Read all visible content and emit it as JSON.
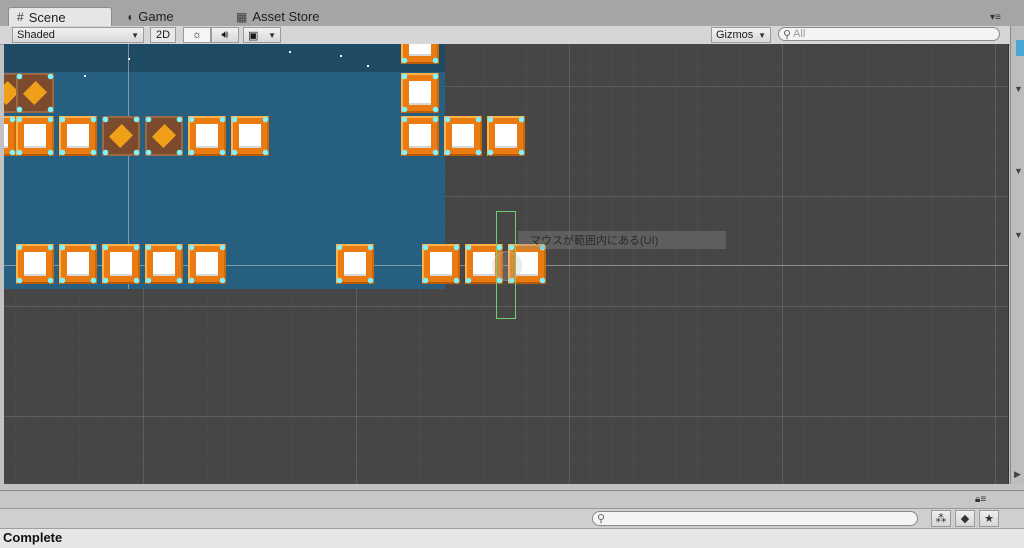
{
  "tabs": [
    {
      "label": "Scene",
      "icon": "grid-icon",
      "active": true
    },
    {
      "label": "Game",
      "icon": "pacman-icon",
      "active": false
    },
    {
      "label": "Asset Store",
      "icon": "store-icon",
      "active": false
    }
  ],
  "toolbar": {
    "shading_mode": "Shaded",
    "toggle_2d": "2D",
    "lighting_icon": "sun-icon",
    "audio_icon": "speaker-icon",
    "effects_icon": "image-icon",
    "gizmos_label": "Gizmos",
    "search_placeholder": "All"
  },
  "scene": {
    "tooltip_text": "マウスが範囲内にある(UI)"
  },
  "console": {
    "search_value": ""
  },
  "status_text": "Complete",
  "colors": {
    "scene_background": "#464646",
    "camera_area": "#265f80",
    "tile_orange": "#e97b12",
    "tile_highlight": "#7ff4ff",
    "selection_outline": "#6fce6f"
  }
}
